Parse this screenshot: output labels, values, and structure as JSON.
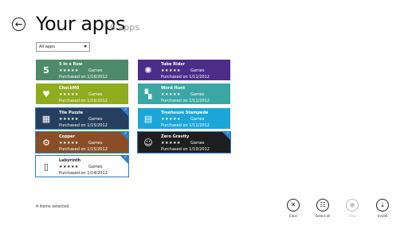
{
  "header": {
    "back_glyph": "←",
    "title": "Your apps",
    "count": "9 apps"
  },
  "filter": {
    "value": "All apps"
  },
  "apps": [
    {
      "name": "5 In a Row",
      "rating": "★★★★★",
      "category": "Games",
      "purchased": "Purchased on 1/16/2012",
      "color": "#4e8a6a",
      "icon": "5",
      "selected": false
    },
    {
      "name": "CheckM8",
      "rating": "★★★★★",
      "category": "Games",
      "purchased": "Purchased on 1/16/2012",
      "color": "#8fab1e",
      "icon": "♥",
      "selected": false
    },
    {
      "name": "Tile Puzzle",
      "rating": "★★★★★",
      "category": "Games",
      "purchased": "Purchased on 1/15/2012",
      "color": "#263f5e",
      "icon": "▦",
      "selected": true
    },
    {
      "name": "Copper",
      "rating": "★★★★★",
      "category": "Games",
      "purchased": "Purchased on 1/15/2012",
      "color": "#8a4d26",
      "icon": "⚙",
      "selected": true
    },
    {
      "name": "Labyrinth",
      "rating": "★★★★★",
      "category": "Games",
      "purchased": "Purchased on 1/14/2012",
      "color": "#ffffff",
      "icon": "▯",
      "selected": true
    },
    {
      "name": "Tube Rider",
      "rating": "★★★★★",
      "category": "Games",
      "purchased": "Purchased on 1/11/2012",
      "color": "#4b2c89",
      "icon": "✺",
      "selected": false
    },
    {
      "name": "Word Hunt",
      "rating": "★★★★★",
      "category": "Games",
      "purchased": "Purchased on 1/11/2012",
      "color": "#3ba7a4",
      "icon": "▚",
      "selected": false
    },
    {
      "name": "Treehouse Stampede",
      "rating": "★★★★★",
      "category": "Games",
      "purchased": "Purchased on 1/11/2012",
      "color": "#1ba6d8",
      "icon": "▤",
      "selected": false
    },
    {
      "name": "Zero Gravity",
      "rating": "★★★★★",
      "category": "Games",
      "purchased": "Purchased on 1/10/2012",
      "color": "#1e1e1e",
      "icon": "☺",
      "selected": true
    }
  ],
  "status": {
    "text": "4 items selected"
  },
  "appbar": {
    "clear": {
      "label": "Clear",
      "glyph": "✕"
    },
    "select_all": {
      "label": "Select all",
      "glyph": "☷"
    },
    "view": {
      "label": "View",
      "glyph": "◉"
    },
    "install": {
      "label": "Install",
      "glyph": "⤓"
    }
  }
}
